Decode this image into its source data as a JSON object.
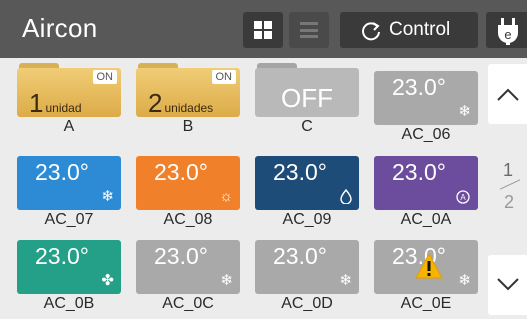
{
  "header": {
    "title": "Aircon",
    "control_label": "Control"
  },
  "tiles": [
    {
      "label": "A",
      "type": "group",
      "status": "ON",
      "count": "1",
      "unit": "unidad"
    },
    {
      "label": "B",
      "type": "group",
      "status": "ON",
      "count": "2",
      "unit": "unidades"
    },
    {
      "label": "C",
      "type": "group-off",
      "text": "OFF"
    },
    {
      "label": "AC_06",
      "type": "unit",
      "temp": "23.0°",
      "mode": "cool",
      "color": "#a9a9a9"
    },
    {
      "label": "AC_07",
      "type": "unit",
      "temp": "23.0°",
      "mode": "cool",
      "color": "#2c8bd4"
    },
    {
      "label": "AC_08",
      "type": "unit",
      "temp": "23.0°",
      "mode": "heat",
      "color": "#f0812a"
    },
    {
      "label": "AC_09",
      "type": "unit",
      "temp": "23.0°",
      "mode": "dry",
      "color": "#1e4c78"
    },
    {
      "label": "AC_0A",
      "type": "unit",
      "temp": "23.0°",
      "mode": "auto",
      "color": "#6c4c9d"
    },
    {
      "label": "AC_0B",
      "type": "unit",
      "temp": "23.0°",
      "mode": "fan",
      "color": "#23a087"
    },
    {
      "label": "AC_0C",
      "type": "unit",
      "temp": "23.0°",
      "mode": "cool",
      "color": "#a9a9a9"
    },
    {
      "label": "AC_0D",
      "type": "unit",
      "temp": "23.0°",
      "mode": "cool",
      "color": "#a9a9a9"
    },
    {
      "label": "AC_0E",
      "type": "unit",
      "temp": "23.0°",
      "mode": "cool",
      "color": "#a9a9a9",
      "warning": true
    }
  ],
  "pagination": {
    "current": "1",
    "total": "2"
  }
}
